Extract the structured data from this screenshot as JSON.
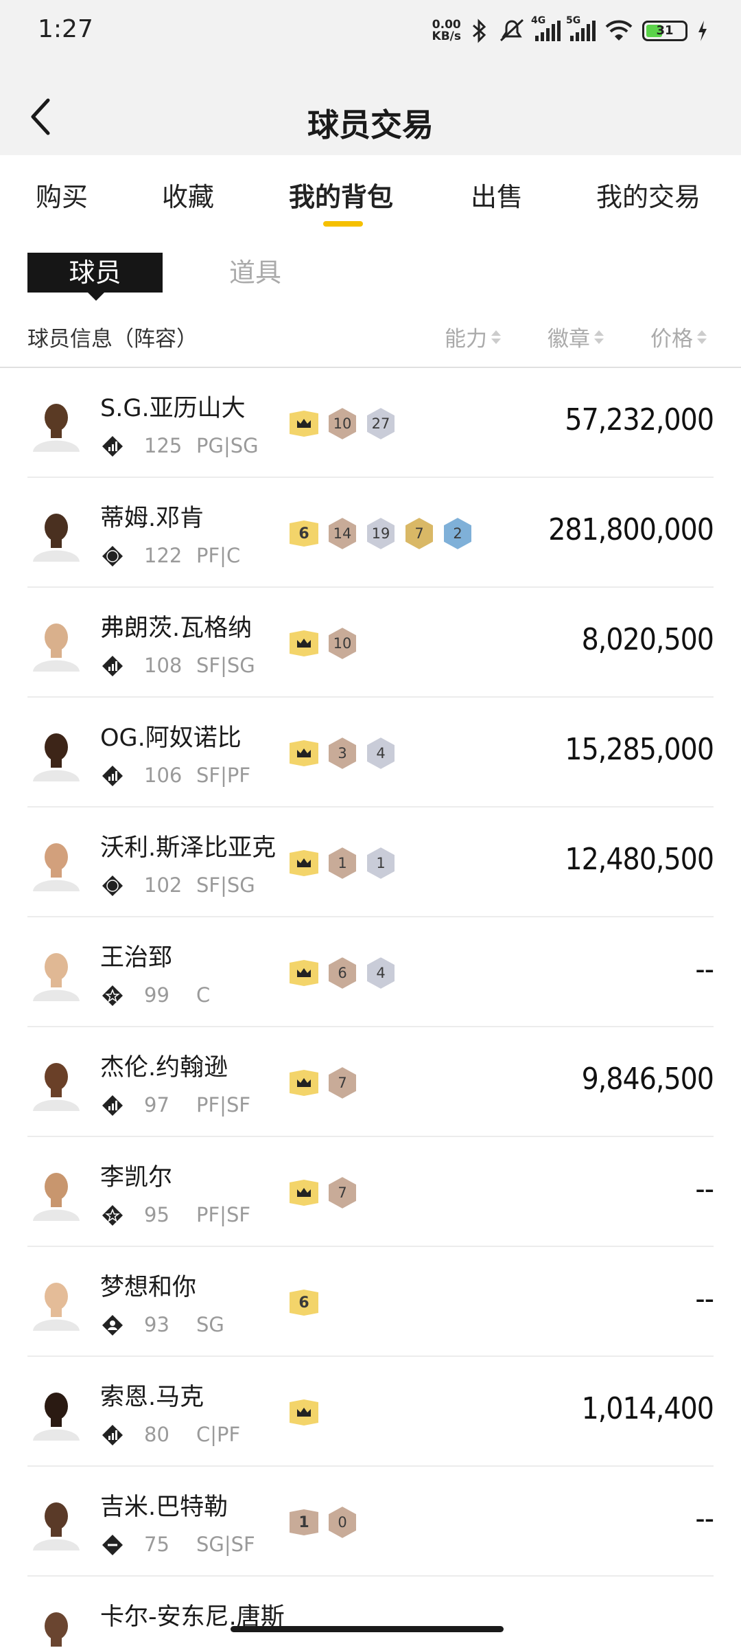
{
  "status_bar": {
    "time": "1:27",
    "net_speed_value": "0.00",
    "net_speed_unit": "KB/s",
    "sim1": "4G",
    "sim2": "5G",
    "battery": "31"
  },
  "header": {
    "title": "球员交易"
  },
  "tabs": [
    {
      "label": "购买"
    },
    {
      "label": "收藏"
    },
    {
      "label": "我的背包",
      "active": true
    },
    {
      "label": "出售"
    },
    {
      "label": "我的交易"
    }
  ],
  "segments": {
    "active": "球员",
    "inactive": "道具"
  },
  "columns": {
    "info": "球员信息（阵容）",
    "ability": "能力",
    "badge": "徽章",
    "price": "价格"
  },
  "players": [
    {
      "name": "S.G.亚历山大",
      "ovr": "125",
      "pos": "PG|SG",
      "tier": "bars",
      "tag": "crown",
      "badges": [
        {
          "n": "10",
          "c": "bronze"
        },
        {
          "n": "27",
          "c": "silver"
        }
      ],
      "price": "57,232,000",
      "skin": "#5a3a24"
    },
    {
      "name": "蒂姆.邓肯",
      "ovr": "122",
      "pos": "PF|C",
      "tier": "04",
      "tag": "6",
      "badges": [
        {
          "n": "14",
          "c": "bronze"
        },
        {
          "n": "19",
          "c": "silver"
        },
        {
          "n": "7",
          "c": "gold"
        },
        {
          "n": "2",
          "c": "blue"
        }
      ],
      "price": "281,800,000",
      "skin": "#4a3020"
    },
    {
      "name": "弗朗茨.瓦格纳",
      "ovr": "108",
      "pos": "SF|SG",
      "tier": "bars",
      "tag": "crown",
      "badges": [
        {
          "n": "10",
          "c": "bronze"
        }
      ],
      "price": "8,020,500",
      "skin": "#d9b08c"
    },
    {
      "name": "OG.阿奴诺比",
      "ovr": "106",
      "pos": "SF|PF",
      "tier": "bars",
      "tag": "crown",
      "badges": [
        {
          "n": "3",
          "c": "bronze"
        },
        {
          "n": "4",
          "c": "silver"
        }
      ],
      "price": "15,285,000",
      "skin": "#3d2518"
    },
    {
      "name": "沃利.斯泽比亚克",
      "ovr": "102",
      "pos": "SF|SG",
      "tier": "02",
      "tag": "crown",
      "badges": [
        {
          "n": "1",
          "c": "bronze"
        },
        {
          "n": "1",
          "c": "silver"
        }
      ],
      "price": "12,480,500",
      "skin": "#d2a07c"
    },
    {
      "name": "王治郅",
      "ovr": "99",
      "pos": "C",
      "tier": "star",
      "tag": "crown",
      "badges": [
        {
          "n": "6",
          "c": "bronze"
        },
        {
          "n": "4",
          "c": "silver"
        }
      ],
      "price": "--",
      "skin": "#e0b894"
    },
    {
      "name": "杰伦.约翰逊",
      "ovr": "97",
      "pos": "PF|SF",
      "tier": "bars",
      "tag": "crown",
      "badges": [
        {
          "n": "7",
          "c": "bronze"
        }
      ],
      "price": "9,846,500",
      "skin": "#6a4028"
    },
    {
      "name": "李凯尔",
      "ovr": "95",
      "pos": "PF|SF",
      "tier": "star",
      "tag": "crown",
      "badges": [
        {
          "n": "7",
          "c": "bronze"
        }
      ],
      "price": "--",
      "skin": "#c8966e"
    },
    {
      "name": "梦想和你",
      "ovr": "93",
      "pos": "SG",
      "tier": "person",
      "tag": "6",
      "badges": [],
      "price": "--",
      "skin": "#e4bc98"
    },
    {
      "name": "索恩.马克",
      "ovr": "80",
      "pos": "C|PF",
      "tier": "bars",
      "tag": "crown",
      "badges": [],
      "price": "1,014,400",
      "skin": "#2a1a12"
    },
    {
      "name": "吉米.巴特勒",
      "ovr": "75",
      "pos": "SG|SF",
      "tier": "copy",
      "tag": "1",
      "tag_style": "bronze",
      "badges": [
        {
          "n": "0",
          "c": "bronze"
        }
      ],
      "price": "--",
      "skin": "#5a3a28"
    },
    {
      "name": "卡尔-安东尼.唐斯",
      "ovr": "",
      "pos": "",
      "tier": "bars",
      "tag": "",
      "badges": [],
      "price": "",
      "skin": "#6a4530"
    }
  ],
  "colors": {
    "accent": "#f5c000",
    "tag_gold": "#f3d46a",
    "bronze": "#c8ab98",
    "silver": "#c9ccd8",
    "gold": "#d9b866",
    "blue": "#7fb0d8"
  },
  "icons": {
    "back": "chevron-left-icon",
    "sort": "sort-arrows-icon",
    "crown": "crown-icon"
  }
}
